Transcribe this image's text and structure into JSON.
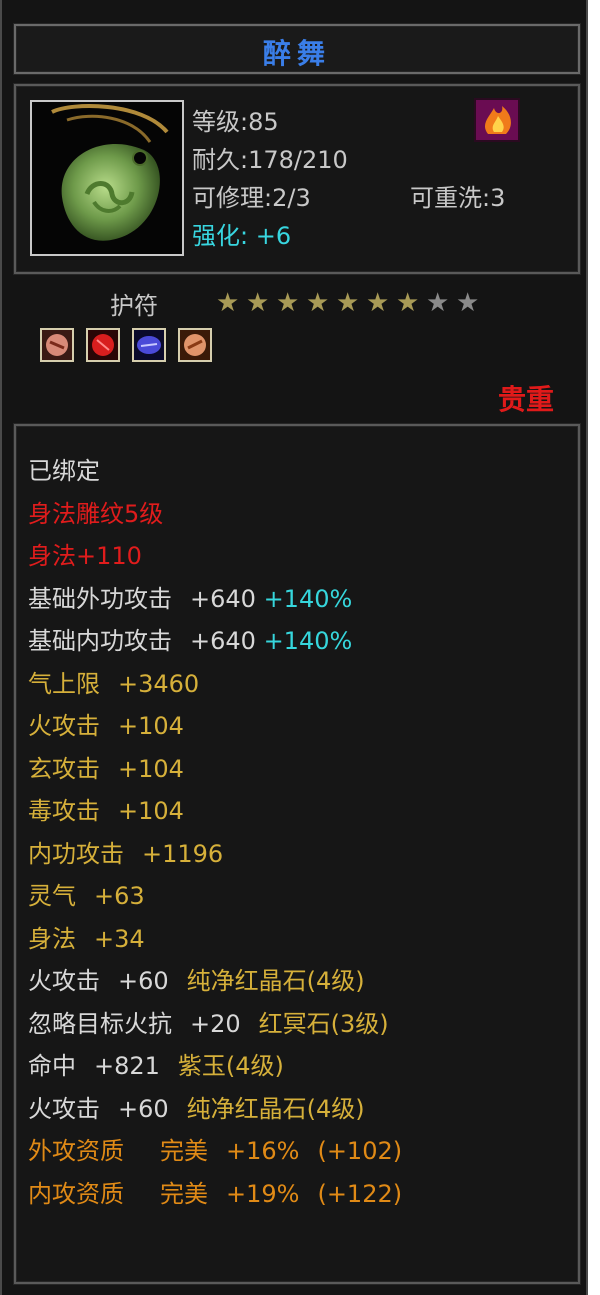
{
  "item": {
    "name": "醉舞",
    "level": "等级:85",
    "durability": "耐久:178/210",
    "repairable": "可修理:2/3",
    "rewash": "可重洗:3",
    "enhance_label": "强化:",
    "enhance_value": "+6",
    "slot": "护符",
    "stars_filled": 7,
    "stars_total": 9,
    "rarity": "贵重",
    "icon": "jade-amulet-icon",
    "element_emblem": "fire-emblem-icon",
    "gem_icons": [
      "pink-gem-icon",
      "red-gem-icon",
      "purple-gem-icon",
      "orange-gem-icon"
    ]
  },
  "attributes": {
    "bound": "已绑定",
    "engraving": "身法雕纹5级",
    "engraving_bonus": "身法+110",
    "base_ext_attack": {
      "label": "基础外功攻击",
      "value": "+640",
      "percent": "+140%"
    },
    "base_int_attack": {
      "label": "基础内功攻击",
      "value": "+640",
      "percent": "+140%"
    },
    "stat_lines": [
      {
        "label": "气上限",
        "value": "+3460"
      },
      {
        "label": "火攻击",
        "value": "+104"
      },
      {
        "label": "玄攻击",
        "value": "+104"
      },
      {
        "label": "毒攻击",
        "value": "+104"
      },
      {
        "label": "内功攻击",
        "value": "+1196"
      },
      {
        "label": "灵气",
        "value": "+63"
      },
      {
        "label": "身法",
        "value": "+34"
      }
    ],
    "gem_lines": [
      {
        "label": "火攻击",
        "value": "+60",
        "gem": "纯净红晶石(4级)"
      },
      {
        "label": "忽略目标火抗",
        "value": "+20",
        "gem": "红冥石(3级)"
      },
      {
        "label": "命中",
        "value": "+821",
        "gem": "紫玉(4级)"
      },
      {
        "label": "火攻击",
        "value": "+60",
        "gem": "纯净红晶石(4级)"
      }
    ],
    "quality_lines": [
      {
        "label": "外攻资质",
        "grade": "完美",
        "percent": "+16%",
        "bonus": "(+102)"
      },
      {
        "label": "内攻资质",
        "grade": "完美",
        "percent": "+19%",
        "bonus": "(+122)"
      }
    ]
  },
  "colors": {
    "title": "#3a7ee8",
    "enhance": "#38d6e0",
    "red": "#e01c1c",
    "gold": "#d6b03a",
    "cyan": "#36d6dc",
    "orange": "#e08a16",
    "star_filled": "#a89a56",
    "star_empty": "#8a8a8a"
  }
}
